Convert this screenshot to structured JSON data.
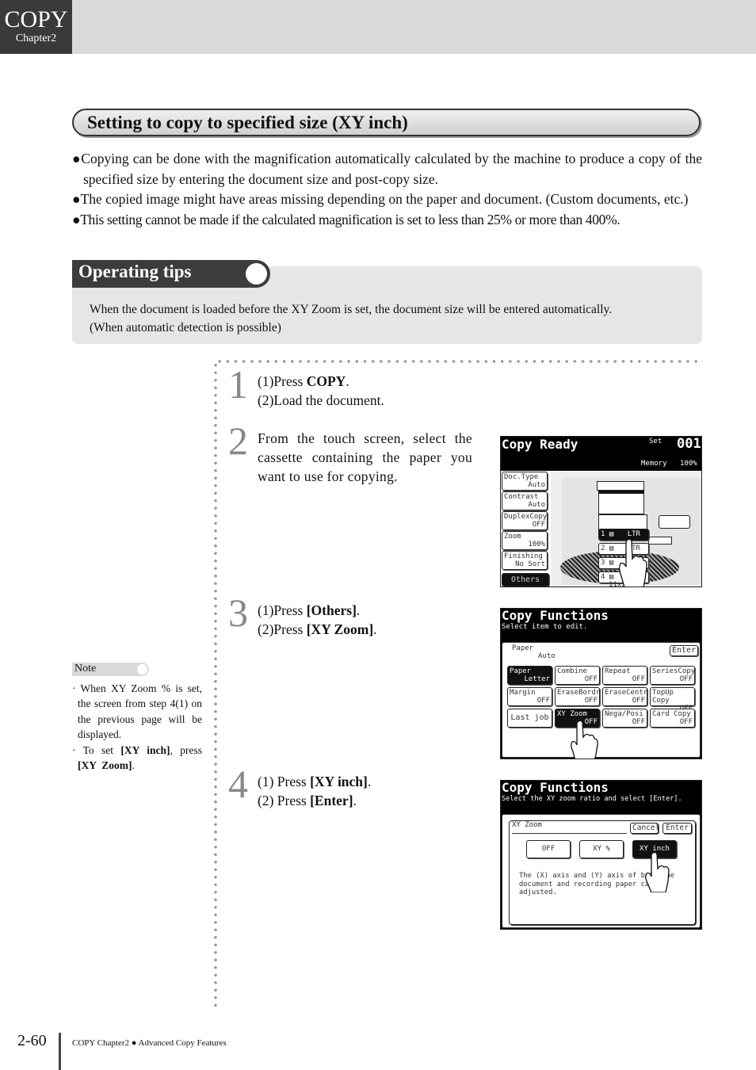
{
  "header": {
    "chapter_title": "COPY",
    "chapter_sub": "Chapter2"
  },
  "section_title": "Setting to copy to specified size (XY inch)",
  "bullets": [
    "●Copying can be done with the magnification automatically calculated by the machine to produce a copy of the specified size by entering the document size and post-copy size.",
    "●The copied image might have areas missing depending on the paper and document. (Custom documents, etc.)",
    "●This setting cannot be made if the calculated magnification is set to less than 25% or more than 400%."
  ],
  "tips": {
    "label": "Operating tips",
    "lines": [
      "When the document is loaded before the XY Zoom is set, the document size will be entered automatically.",
      "(When automatic detection is possible)"
    ]
  },
  "steps": [
    {
      "num": "1",
      "lines": [
        [
          "(1)Press ",
          "COPY",
          "."
        ],
        [
          "(2)Load the document."
        ]
      ]
    },
    {
      "num": "2",
      "text": "From the touch screen, select the cassette containing the paper you want to use for copying."
    },
    {
      "num": "3",
      "lines": [
        [
          "(1)Press ",
          "[Others]",
          "."
        ],
        [
          "(2)Press ",
          "[XY Zoom]",
          "."
        ]
      ]
    },
    {
      "num": "4",
      "lines": [
        [
          "(1) Press ",
          "[XY inch]",
          "."
        ],
        [
          "(2) Press ",
          "[Enter]",
          "."
        ]
      ]
    }
  ],
  "screen1": {
    "title": "Copy Ready",
    "set_label": "Set",
    "count": "001",
    "memory_label": "Memory",
    "memory_value": "100%",
    "buttons": [
      [
        "Doc.Type",
        "Auto"
      ],
      [
        "Contrast",
        "Auto"
      ],
      [
        "DuplexCopy",
        "OFF"
      ],
      [
        "Zoom",
        "100%"
      ],
      [
        "Finishing",
        "No Sort"
      ]
    ],
    "others": "Others",
    "trays": [
      {
        "n": "1",
        "size": "LTR"
      },
      {
        "n": "2",
        "size": "LTR"
      },
      {
        "n": "3",
        "size": ""
      },
      {
        "n": "4",
        "size": "11x17"
      }
    ]
  },
  "screen2": {
    "title": "Copy Functions",
    "subtitle": "Select item to edit.",
    "paper_label": "Paper",
    "paper_value": "Auto",
    "enter": "Enter",
    "grid": [
      [
        "Paper",
        "Letter"
      ],
      [
        "Combine",
        "OFF"
      ],
      [
        "Repeat",
        "OFF"
      ],
      [
        "SeriesCopy",
        "OFF"
      ],
      [
        "Margin",
        "OFF"
      ],
      [
        "EraseBordr",
        "OFF"
      ],
      [
        "EraseCentr",
        "OFF"
      ],
      [
        "TopUp Copy",
        "OFF"
      ],
      [
        "Last job",
        ""
      ],
      [
        "XY Zoom",
        "OFF"
      ],
      [
        "Nega/Posi",
        "OFF"
      ],
      [
        "Card Copy",
        "OFF"
      ]
    ]
  },
  "screen3": {
    "title": "Copy Functions",
    "subtitle": "Select the XY zoom ratio and select [Enter].",
    "dialog_title": "XY Zoom",
    "cancel": "Cancel",
    "enter": "Enter",
    "options": [
      "OFF",
      "XY %",
      "XY inch"
    ],
    "selected": "XY inch",
    "description": "The (X) axis and (Y) axis of both the document and recording paper can be adjusted."
  },
  "note": {
    "label": "Note",
    "items": [
      [
        "· When XY Zoom % is set, the screen from step 4(1) on the previous page will be displayed."
      ],
      [
        "· To set ",
        "[XY inch]",
        ", press ",
        "[XY  Zoom]",
        "."
      ]
    ]
  },
  "footer": {
    "page": "2-60",
    "text": "COPY Chapter2 ● Advanced Copy Features"
  }
}
